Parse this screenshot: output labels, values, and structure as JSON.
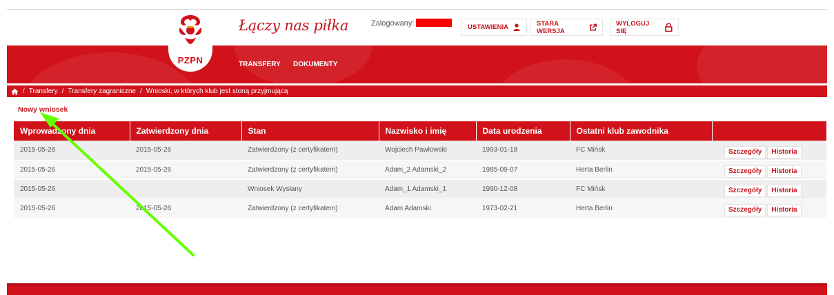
{
  "header": {
    "logo_text": "PZPN",
    "slogan": "Łączy nas piłka",
    "user_label": "Zalogowany:",
    "buttons": {
      "settings": "USTAWIENIA",
      "old_version": "STARA WERSJA",
      "logout": "WYLOGUJ SIĘ"
    },
    "icons": {
      "settings": "user-icon",
      "old_version": "external-link-icon",
      "logout": "lock-icon"
    }
  },
  "nav": {
    "transfers": "TRANSFERY",
    "documents": "DOKUMENTY"
  },
  "breadcrumb": {
    "sep": "/",
    "items": [
      "Transfery",
      "Transfery zagraniczne",
      "Wnioski, w których klub jest stoną przyjmującą"
    ]
  },
  "actions": {
    "new_request": "Nowy wniosek",
    "details": "Szczegóły",
    "history": "Historia"
  },
  "table": {
    "headers": [
      "Wprowadzony dnia",
      "Zatwierdzony dnia",
      "Stan",
      "Nazwisko i imię",
      "Data urodzenia",
      "Ostatni klub zawodnika",
      ""
    ],
    "rows": [
      [
        "2015-05-26",
        "2015-05-26",
        "Zatwierdzony (z certyfikatem)",
        "Wojciech Pawłowski",
        "1993-01-18",
        "FC Mińsk"
      ],
      [
        "2015-05-26",
        "2015-05-26",
        "Zatwierdzony (z certyfikatem)",
        "Adam_2 Adamski_2",
        "1985-09-07",
        "Herta Berlin"
      ],
      [
        "2015-05-26",
        "",
        "Wniosek Wysłany",
        "Adam_1 Adamski_1",
        "1990-12-08",
        "FC Mińsk"
      ],
      [
        "2015-05-26",
        "2015-05-26",
        "Zatwierdzony (z certyfikatem)",
        "Adam Adamski",
        "1973-02-21",
        "Herta Berlin"
      ]
    ]
  },
  "colors": {
    "brand_red": "#d1121a",
    "arrow_green": "#66ff00",
    "redaction": "#ff0000"
  }
}
